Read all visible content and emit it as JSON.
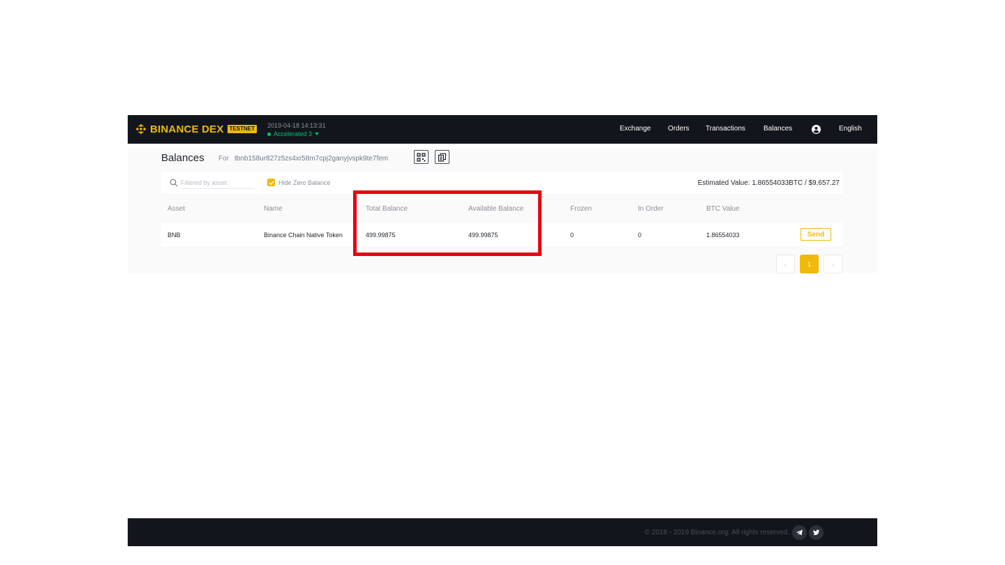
{
  "nav": {
    "brand": "BINANCE DEX",
    "badge": "TESTNET",
    "timestamp": "2019-04-18 14:13:31",
    "status": "Accelerated 3",
    "links": [
      "Exchange",
      "Orders",
      "Transactions",
      "Balances"
    ],
    "language": "English"
  },
  "page": {
    "title": "Balances",
    "for_label": "For",
    "address": "tbnb158ur827z5zs4xr58m7cpj2ganyjvspk9te7fem"
  },
  "filter": {
    "placeholder": "Filtered by asset",
    "hide_zero_label": "Hide Zero Balance",
    "hide_zero_checked": true,
    "estimated_value": "Estimated Value: 1.86554033BTC / $9,657.27"
  },
  "table": {
    "headers": [
      "Asset",
      "Name",
      "Total Balance",
      "Available Balance",
      "Frozen",
      "In Order",
      "BTC Value"
    ],
    "rows": [
      {
        "asset": "BNB",
        "name": "Binance Chain Native Token",
        "total": "499.99875",
        "available": "499.99875",
        "frozen": "0",
        "in_order": "0",
        "btc_value": "1.86554033",
        "action": "Send"
      }
    ]
  },
  "pagination": {
    "prev": "‹",
    "current": "1",
    "next": "›"
  },
  "footer": {
    "copyright": "© 2018 - 2019 Binance.org. All rights reserved."
  },
  "colors": {
    "brand": "#f0b90b",
    "nav_bg": "#12161c",
    "status_green": "#02c076",
    "highlight": "#e60012"
  }
}
